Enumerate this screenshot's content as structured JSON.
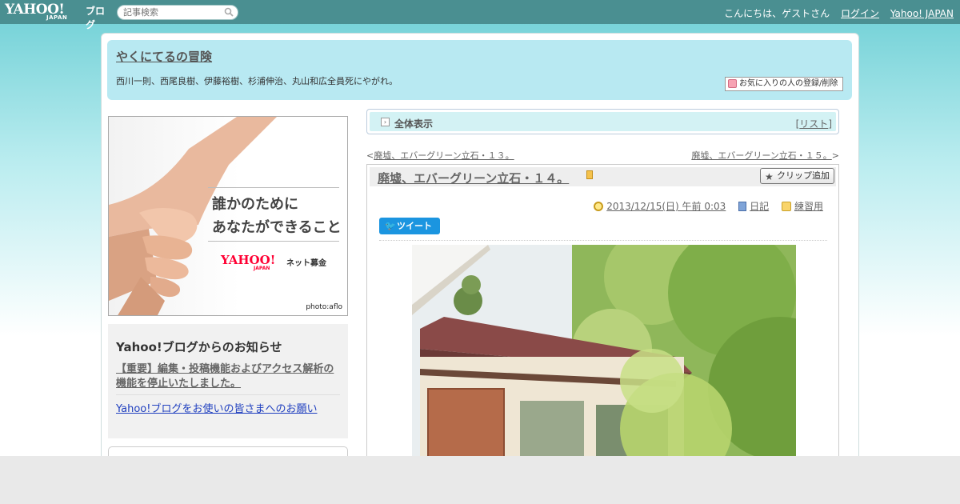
{
  "masthead": {
    "logo_text": "YAHOO!",
    "logo_sub": "JAPAN",
    "blog_label": "ブログ",
    "search_placeholder": "記事検索",
    "greeting": "こんにちは、ゲストさん",
    "login_label": "ログイン",
    "yahoo_japan_label": "Yahoo! JAPAN"
  },
  "blog": {
    "title": "やくにてるの冒険",
    "description": "西川一則、西尾良樹、伊藤裕樹、杉浦伸治、丸山和広全員死にやがれ。",
    "favorite_button": "お気に入りの人の登録/削除"
  },
  "sidebar": {
    "ad": {
      "line1": "誰かのために",
      "line2": "あなたができること",
      "logo_text": "YAHOO!",
      "logo_sub": "JAPAN",
      "service": "ネット募金",
      "credit": "photo:aflo"
    },
    "notice": {
      "title": "Yahoo!ブログからのお知らせ",
      "link1": "【重要】編集・投稿機能およびアクセス解析の機能を停止いたしました。",
      "link2": "Yahoo!ブログをお使いの皆さまへのお願い"
    }
  },
  "category_bar": {
    "label": "全体表示",
    "list_open": "[",
    "list_label": "リスト",
    "list_close": "]"
  },
  "pager": {
    "prev_arrow": "<",
    "prev_title": "廃墟、エバーグリーン立石・１３。",
    "next_title": "廃墟、エバーグリーン立石・１５。",
    "next_arrow": ">"
  },
  "article": {
    "title": "廃墟、エバーグリーン立石・１４。",
    "clip_label": "クリップ追加",
    "date": "2013/12/15(日) 午前 0:03",
    "category": "日記",
    "folder": "練習用",
    "tweet_label": "ツイート"
  },
  "colors": {
    "masthead_bg": "#4a8f91",
    "header_bg": "#b8e9f2",
    "tweet_blue": "#1b95e0"
  }
}
